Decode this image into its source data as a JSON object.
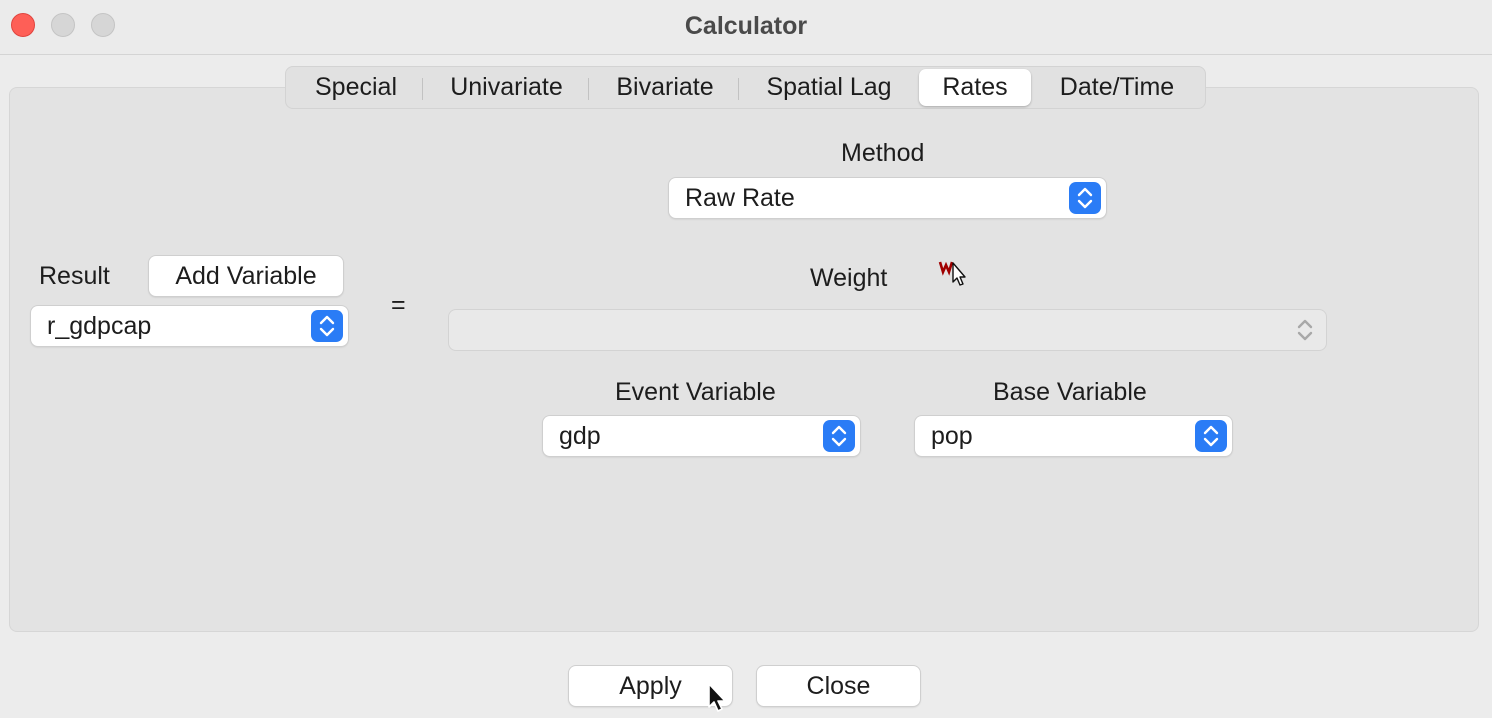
{
  "window": {
    "title": "Calculator"
  },
  "tabs": [
    {
      "label": "Special"
    },
    {
      "label": "Univariate"
    },
    {
      "label": "Bivariate"
    },
    {
      "label": "Spatial Lag"
    },
    {
      "label": "Rates",
      "active": true
    },
    {
      "label": "Date/Time"
    }
  ],
  "method": {
    "label": "Method",
    "value": "Raw Rate"
  },
  "result": {
    "label": "Result",
    "add_variable_label": "Add Variable",
    "value": "r_gdpcap"
  },
  "equals": "=",
  "weight": {
    "label": "Weight",
    "value": ""
  },
  "event_variable": {
    "label": "Event Variable",
    "value": "gdp"
  },
  "base_variable": {
    "label": "Base Variable",
    "value": "pop"
  },
  "footer": {
    "apply_label": "Apply",
    "close_label": "Close"
  },
  "colors": {
    "accent": "#2a7cf6",
    "close_traffic": "#fe5f57",
    "weight_icon": "#a00000"
  },
  "icons": {
    "weights_manager": "weights-icon",
    "pointer": "cursor-icon"
  }
}
